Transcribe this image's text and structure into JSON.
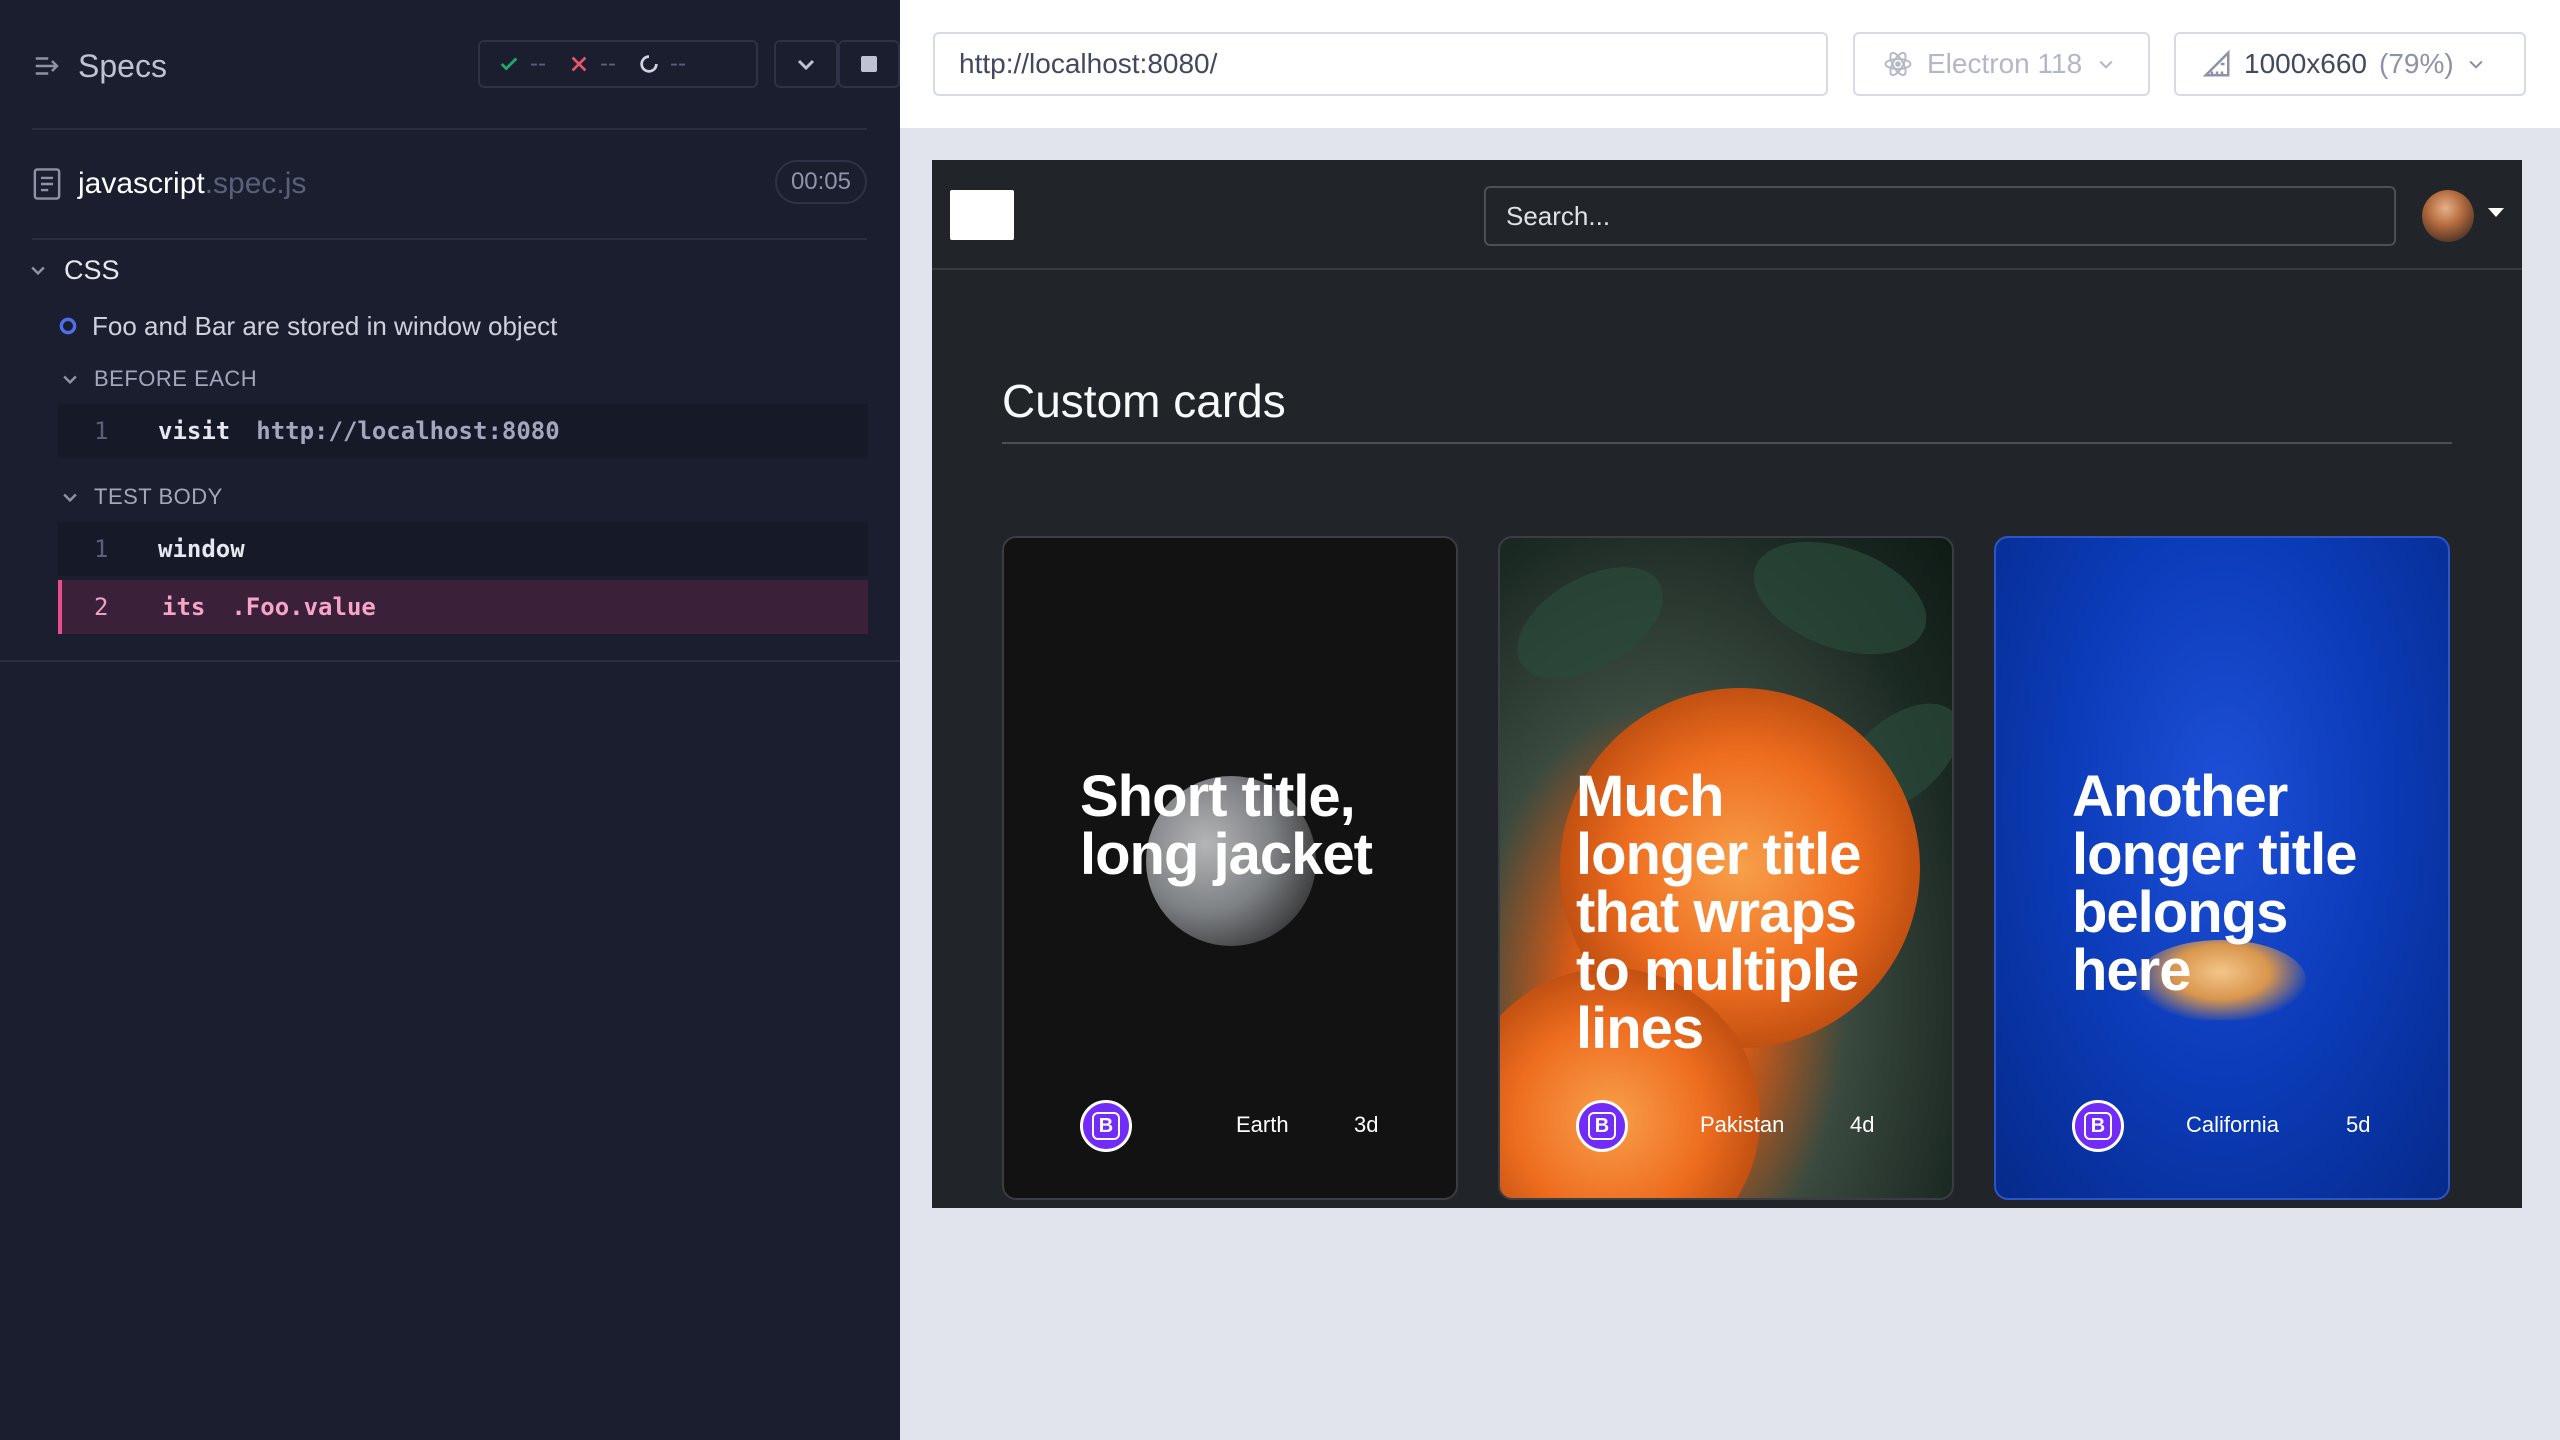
{
  "reporter": {
    "specs_label": "Specs",
    "stats": {
      "passed": "--",
      "failed": "--",
      "pending": "--"
    },
    "file": {
      "name": "javascript",
      "ext": ".spec.js",
      "duration": "00:05"
    },
    "suite": "CSS",
    "test": "Foo and Bar are stored in window object",
    "before_each": {
      "label": "BEFORE EACH",
      "commands": [
        {
          "num": "1",
          "name": "visit",
          "message": "http://localhost:8080"
        }
      ]
    },
    "test_body": {
      "label": "TEST BODY",
      "commands": [
        {
          "num": "1",
          "name": "window",
          "message": ""
        },
        {
          "num": "2",
          "name": "its",
          "message": ".Foo.value"
        }
      ]
    }
  },
  "aut": {
    "url": "http://localhost:8080/",
    "browser": "Electron 118",
    "viewport": "1000x660",
    "scale": "(79%)",
    "colors": {
      "pass": "#1fa971",
      "fail": "#e45770",
      "accent": "#712cf9"
    }
  },
  "page": {
    "search_placeholder": "Search...",
    "section_title": "Custom cards",
    "cards": [
      {
        "title": "Short title, long jacket",
        "icon": "B",
        "location": "Earth",
        "days": "3d"
      },
      {
        "title": "Much longer title that wraps to multiple lines",
        "icon": "B",
        "location": "Pakistan",
        "days": "4d"
      },
      {
        "title": "Another longer title belongs here",
        "icon": "B",
        "location": "California",
        "days": "5d"
      }
    ]
  }
}
